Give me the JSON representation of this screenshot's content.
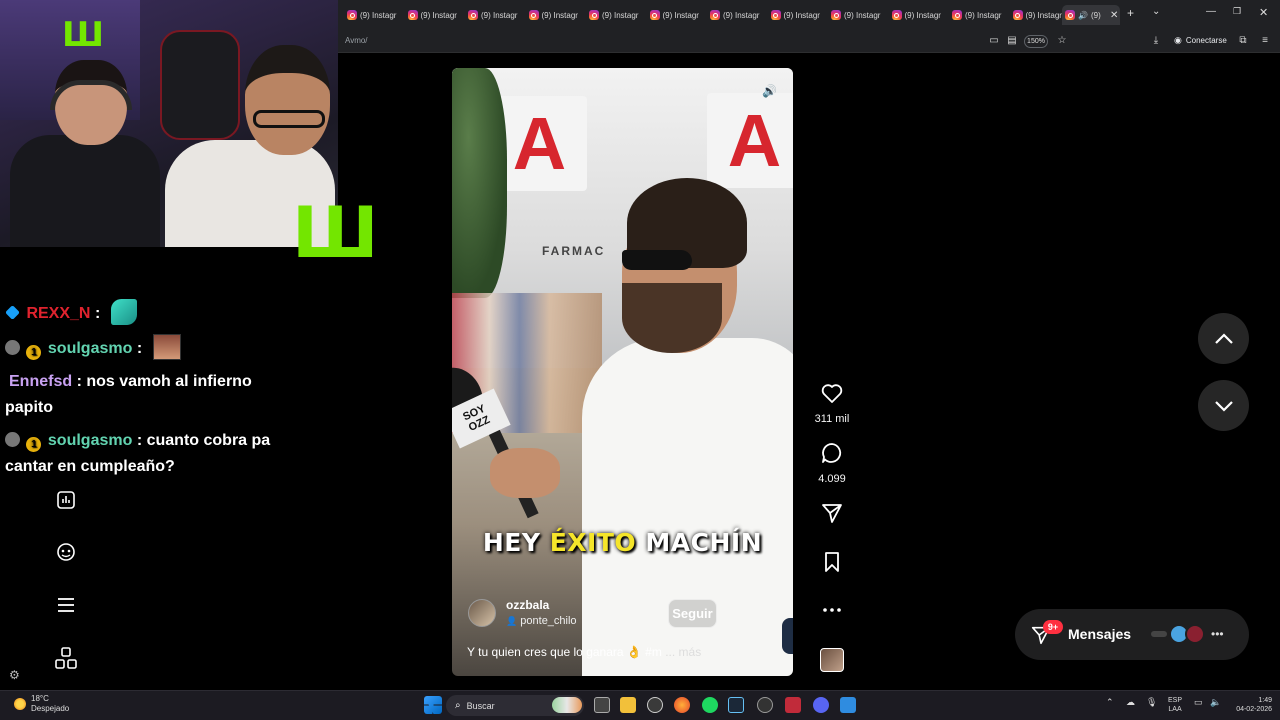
{
  "browser": {
    "tabs": [
      {
        "label": "(9) Instagr"
      },
      {
        "label": "(9) Instagr"
      },
      {
        "label": "(9) Instagr"
      },
      {
        "label": "(9) Instagr"
      },
      {
        "label": "(9) Instagr"
      },
      {
        "label": "(9) Instagr"
      },
      {
        "label": "(9) Instagr"
      },
      {
        "label": "(9) Instagr"
      },
      {
        "label": "(9) Instagr"
      },
      {
        "label": "(9) Instagr"
      },
      {
        "label": "(9) Instagr"
      },
      {
        "label": "(9) Instagr"
      }
    ],
    "active_tab_label": "(9)",
    "new_tab_icon": "plus-icon",
    "url": "Avmo/",
    "zoom": "150%",
    "connect_label": "Conectarse"
  },
  "stream_overlay": {
    "chat": [
      {
        "badges": [
          "cube"
        ],
        "user": "REXX_N",
        "separator": ":",
        "text": "",
        "emote": "feather"
      },
      {
        "badges": [
          "bot",
          "coin"
        ],
        "user": "soulgasmo",
        "separator": ":",
        "text": "",
        "emote": "face"
      },
      {
        "badges": [],
        "user": "Ennefsd",
        "separator": ":",
        "text": "nos vamoh al infierno",
        "text2": "papito"
      },
      {
        "badges": [
          "bot",
          "coin"
        ],
        "user": "soulgasmo",
        "separator": ":",
        "text": "cuanto cobra pa",
        "text2": "cantar en cumpleaño?"
      }
    ],
    "coin_glyph": "1"
  },
  "reel": {
    "sign_letter": "A",
    "storefront": "FARMAC",
    "mic_flag": "SOY\nOZZ",
    "caption_words": [
      "HEY",
      "ÉXITO",
      "MACHÍN"
    ],
    "author": "ozzbala",
    "audio": "ponte_chilo",
    "follow_label": "Seguir",
    "description": "Y tu quien cres que lo ganara 👌 #m",
    "more_label": "... más",
    "likes": "311 mil",
    "comments": "4.099"
  },
  "messages": {
    "label": "Mensajes",
    "badge": "9+"
  },
  "taskbar": {
    "weather_temp": "18°C",
    "weather_desc": "Despejado",
    "search_label": "Buscar",
    "lang_1": "ESP",
    "lang_2": "LAA",
    "time": "1:49",
    "date": "04-02-2026"
  },
  "colors": {
    "accent_yellow": "#f5e52a",
    "notification_red": "#ff3040",
    "monster_green": "#73e600"
  }
}
